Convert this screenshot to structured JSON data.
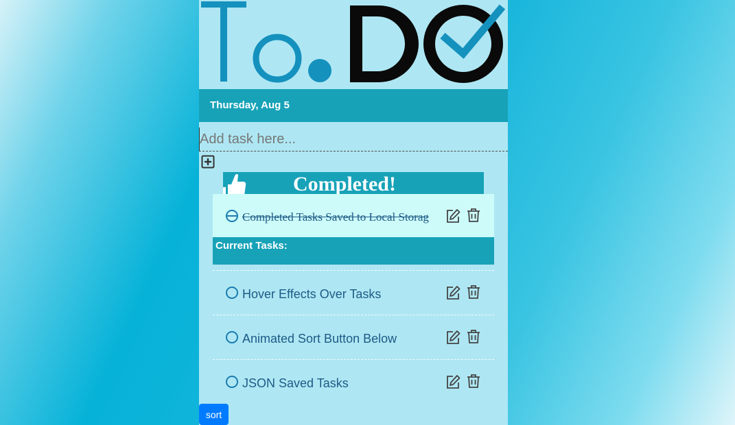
{
  "logo": {
    "text_left": "To.",
    "text_right": "DO",
    "alt": "To.DO"
  },
  "header": {
    "date": "Thursday, Aug 5"
  },
  "input": {
    "placeholder": "Add task here...",
    "value": ""
  },
  "completed": {
    "title": "Completed!",
    "items": [
      {
        "text": "Completed Tasks Saved to Local Storag"
      }
    ]
  },
  "current": {
    "header": "Current Tasks:",
    "items": [
      {
        "text": "Hover Effects Over Tasks"
      },
      {
        "text": "Animated Sort Button Below"
      },
      {
        "text": "JSON Saved Tasks"
      }
    ]
  },
  "sort": {
    "label": "sort"
  },
  "colors": {
    "panel": "#aee7f3",
    "accent": "#17a2b8",
    "done_row": "#ccfbf9",
    "logo_blue": "#1591be",
    "logo_dark": "#0a0a0a",
    "task_text": "#1d5a86",
    "sort_button": "#007bff"
  },
  "icons": [
    "plus-square-icon",
    "thumbs-up-icon",
    "circle-icon",
    "edit-icon",
    "trash-icon"
  ]
}
